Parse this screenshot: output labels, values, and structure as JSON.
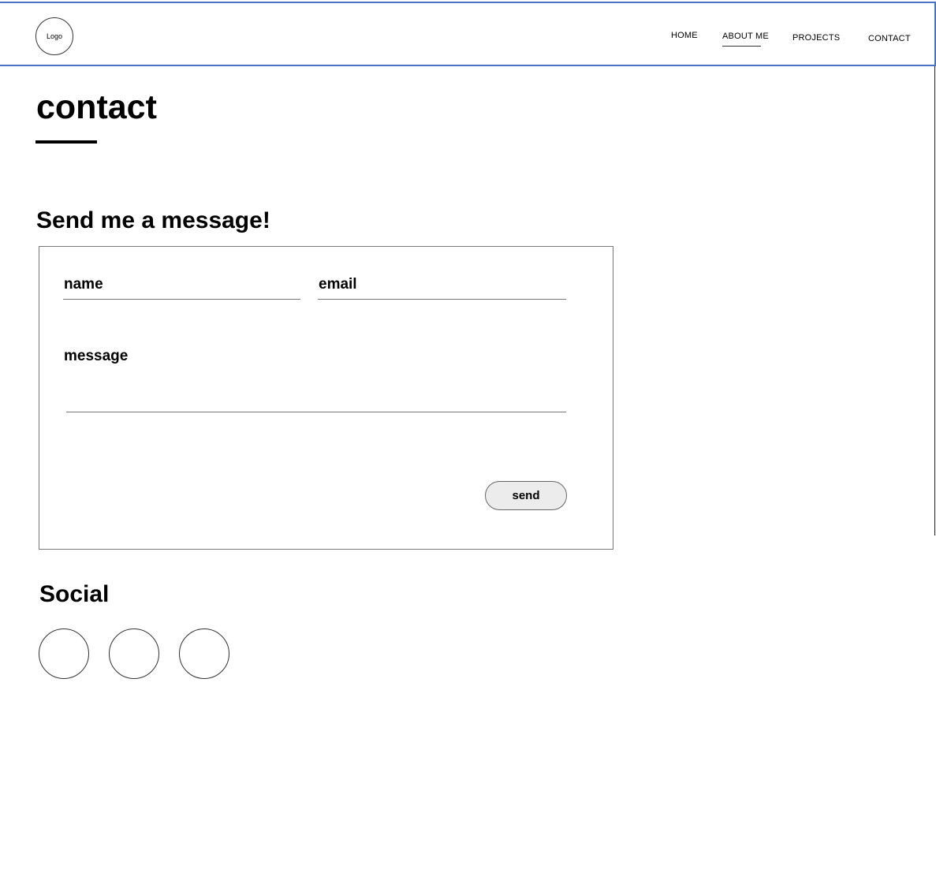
{
  "header": {
    "logo_text": "Logo",
    "nav": {
      "home": "HOME",
      "about": "ABOUT ME",
      "projects": "PROJECTS",
      "contact": "CONTACT"
    },
    "accent_color": "#4a72c6"
  },
  "main": {
    "page_title": "contact",
    "form_heading": "Send me a message!",
    "form": {
      "name_label": "name",
      "email_label": "email",
      "message_label": "message",
      "send_label": "send"
    },
    "social": {
      "heading": "Social",
      "links": [
        {
          "icon": "social-icon-placeholder"
        },
        {
          "icon": "social-icon-placeholder"
        },
        {
          "icon": "social-icon-placeholder"
        }
      ]
    }
  }
}
